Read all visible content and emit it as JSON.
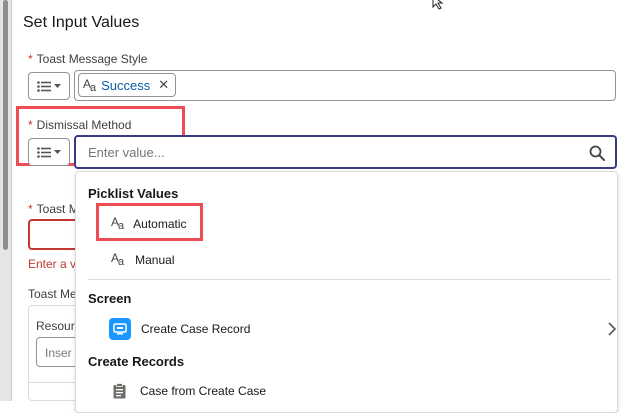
{
  "section_title": "Set Input Values",
  "toast_style": {
    "label": "Toast Message Style",
    "required_mark": "*",
    "pill_value": "Success",
    "pill_remove_glyph": "✕",
    "pill_icon": "text-aa-icon"
  },
  "dismissal": {
    "label": "Dismissal Method",
    "required_mark": "*",
    "placeholder": "Enter value...",
    "search_icon": "search-icon"
  },
  "background": {
    "toast_message_label": "Toast M",
    "required_mark": "*",
    "error_text": "Enter a va",
    "toast_message_label_2": "Toast Me",
    "resource_label": "Resour",
    "insert_placeholder": "Inser"
  },
  "dropdown": {
    "groups": [
      {
        "header": "Picklist Values",
        "options": [
          {
            "label": "Automatic",
            "icon": "text-aa-icon"
          },
          {
            "label": "Manual",
            "icon": "text-aa-icon"
          }
        ]
      },
      {
        "header": "Screen",
        "options": [
          {
            "label": "Create Case Record",
            "icon": "screen-icon",
            "has_submenu": true
          }
        ]
      },
      {
        "header": "Create Records",
        "options": [
          {
            "label": "Case from Create Case",
            "icon": "clipboard-icon"
          }
        ]
      }
    ]
  },
  "colors": {
    "highlight": "#ef4d56",
    "required": "#c23934",
    "pill_text": "#0b5cab",
    "focus_border": "#3a3a8c",
    "screen_icon_bg": "#1b96ff"
  }
}
